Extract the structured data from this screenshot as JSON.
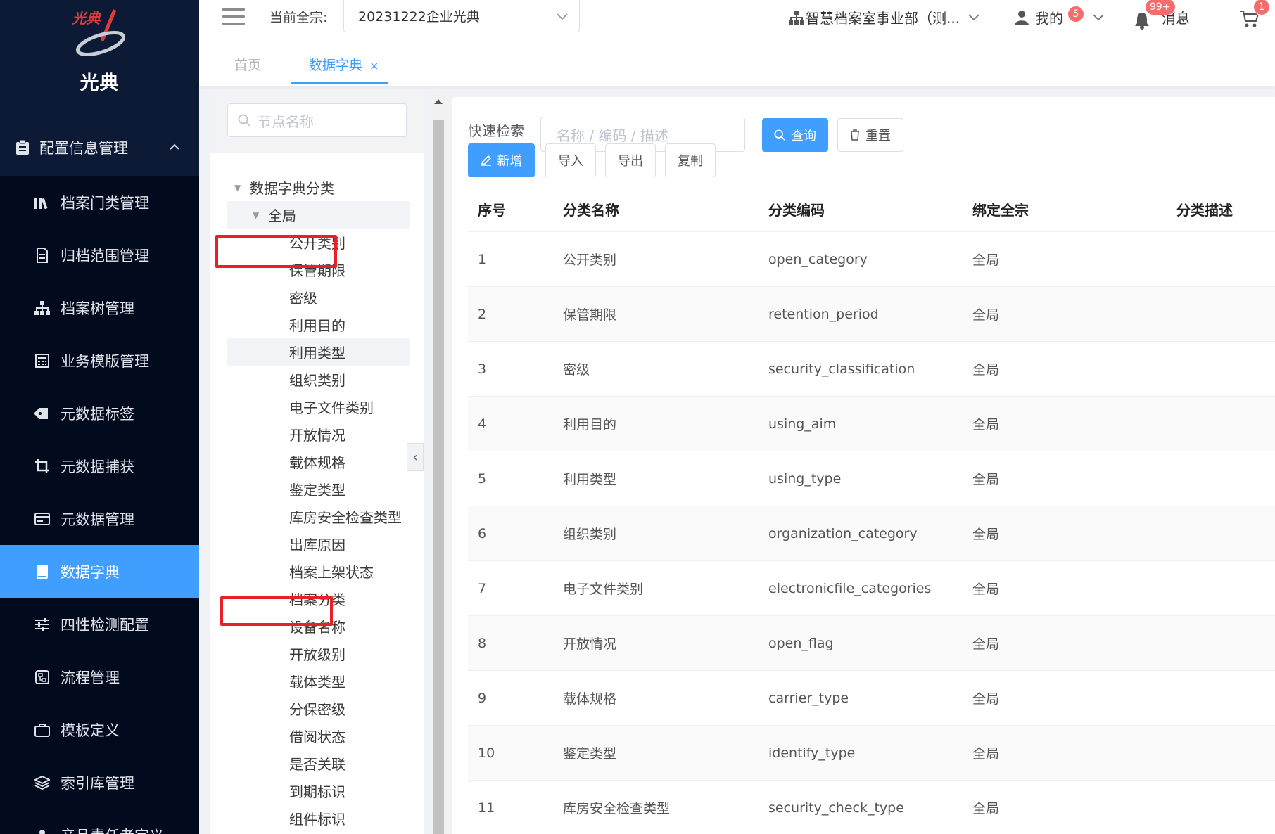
{
  "app": {
    "logo_text": "光典",
    "logo_brand": "光典"
  },
  "sidebar": {
    "parent": {
      "label": "配置信息管理",
      "icon": "clipboard-icon"
    },
    "items": [
      {
        "label": "档案门类管理",
        "icon": "books-icon"
      },
      {
        "label": "归档范围管理",
        "icon": "document-icon"
      },
      {
        "label": "档案树管理",
        "icon": "org-tree-icon"
      },
      {
        "label": "业务模版管理",
        "icon": "calculator-icon"
      },
      {
        "label": "元数据标签",
        "icon": "tag-icon"
      },
      {
        "label": "元数据捕获",
        "icon": "crop-icon"
      },
      {
        "label": "元数据管理",
        "icon": "card-icon"
      },
      {
        "label": "数据字典",
        "icon": "book-icon",
        "active": true
      },
      {
        "label": "四性检测配置",
        "icon": "sliders-icon"
      },
      {
        "label": "流程管理",
        "icon": "flow-icon"
      },
      {
        "label": "模板定义",
        "icon": "briefcase-icon"
      },
      {
        "label": "索引库管理",
        "icon": "layers-icon"
      },
      {
        "label": "产品责任者定义",
        "icon": "user-icon"
      }
    ]
  },
  "header": {
    "fonds_label": "当前全宗:",
    "fonds_value": "20231222企业光典",
    "org_name": "智慧档案室事业部（测...",
    "me_label": "我的",
    "me_badge": "5",
    "msg_label": "消息",
    "msg_badge": "99+",
    "cart_badge": "1"
  },
  "tabs": [
    {
      "label": "首页"
    },
    {
      "label": "数据字典",
      "active": true,
      "close": "×"
    }
  ],
  "tree": {
    "search_placeholder": "节点名称",
    "root": "数据字典分类",
    "level1": "全局",
    "children": [
      "公开类别",
      "保管期限",
      "密级",
      "利用目的",
      "利用类型",
      "组织类别",
      "电子文件类别",
      "开放情况",
      "载体规格",
      "鉴定类型",
      "库房安全检查类型",
      "出库原因",
      "档案上架状态",
      "档案分类",
      "设备名称",
      "开放级别",
      "载体类型",
      "分保密级",
      "借阅状态",
      "是否关联",
      "到期标识",
      "组件标识"
    ],
    "collapse_glyph": "‹"
  },
  "search": {
    "label": "快速检索",
    "placeholder": "名称 / 编码 / 描述",
    "query_label": "查询",
    "reset_label": "重置"
  },
  "toolbar": {
    "add_label": "新增",
    "import_label": "导入",
    "export_label": "导出",
    "copy_label": "复制"
  },
  "table": {
    "columns": [
      "序号",
      "分类名称",
      "分类编码",
      "绑定全宗",
      "分类描述"
    ],
    "rows": [
      [
        "1",
        "公开类别",
        "open_category",
        "全局",
        ""
      ],
      [
        "2",
        "保管期限",
        "retention_period",
        "全局",
        ""
      ],
      [
        "3",
        "密级",
        "security_classification",
        "全局",
        ""
      ],
      [
        "4",
        "利用目的",
        "using_aim",
        "全局",
        ""
      ],
      [
        "5",
        "利用类型",
        "using_type",
        "全局",
        ""
      ],
      [
        "6",
        "组织类别",
        "organization_category",
        "全局",
        ""
      ],
      [
        "7",
        "电子文件类别",
        "electronicfile_categories",
        "全局",
        ""
      ],
      [
        "8",
        "开放情况",
        "open_flag",
        "全局",
        ""
      ],
      [
        "9",
        "载体规格",
        "carrier_type",
        "全局",
        ""
      ],
      [
        "10",
        "鉴定类型",
        "identify_type",
        "全局",
        ""
      ],
      [
        "11",
        "库房安全检查类型",
        "security_check_type",
        "全局",
        ""
      ]
    ]
  },
  "colors": {
    "sidebar_bg": "#0c1a36",
    "sidebar_sub_bg": "#020a1d",
    "accent": "#409eff",
    "highlight_box": "#e8202a",
    "badge": "#f56c6c"
  }
}
